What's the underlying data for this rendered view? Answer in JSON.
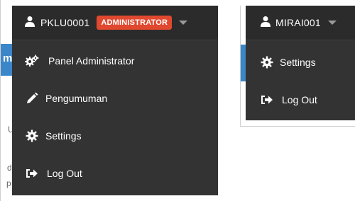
{
  "background": {
    "bluebar_letter": "m",
    "fragments": [
      "U",
      "da",
      "p"
    ]
  },
  "left_menu": {
    "username": "PKLU0001",
    "role_badge": "ADMINISTRATOR",
    "items": [
      {
        "label": "Panel Administrator",
        "icon": "gears-icon"
      },
      {
        "label": "Pengumuman",
        "icon": "pencil-icon"
      },
      {
        "label": "Settings",
        "icon": "gear-icon"
      },
      {
        "label": "Log Out",
        "icon": "sign-out-icon"
      }
    ]
  },
  "right_menu": {
    "username": "MIRAI001",
    "items": [
      {
        "label": "Settings",
        "icon": "gear-icon"
      },
      {
        "label": "Log Out",
        "icon": "sign-out-icon"
      }
    ]
  },
  "colors": {
    "menu_bg": "#333333",
    "badge_bg": "#e0492f",
    "accent_blue": "#3a86c8"
  }
}
